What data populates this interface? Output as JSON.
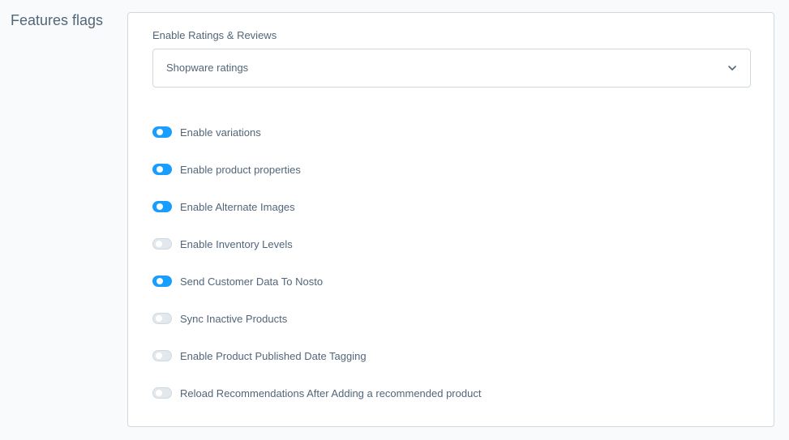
{
  "section": {
    "title": "Features flags"
  },
  "ratings": {
    "label": "Enable Ratings & Reviews",
    "selected": "Shopware ratings"
  },
  "toggles": [
    {
      "label": "Enable variations",
      "on": true
    },
    {
      "label": "Enable product properties",
      "on": true
    },
    {
      "label": "Enable Alternate Images",
      "on": true
    },
    {
      "label": "Enable Inventory Levels",
      "on": false
    },
    {
      "label": "Send Customer Data To Nosto",
      "on": true
    },
    {
      "label": "Sync Inactive Products",
      "on": false
    },
    {
      "label": "Enable Product Published Date Tagging",
      "on": false
    },
    {
      "label": "Reload Recommendations After Adding a recommended product",
      "on": false
    }
  ],
  "colors": {
    "accent": "#189eff",
    "text": "#52667a",
    "border": "#d1d9e0",
    "toggle_off": "#e3e8ec"
  },
  "icons": {
    "select_chevron": "chevron-down-icon"
  }
}
